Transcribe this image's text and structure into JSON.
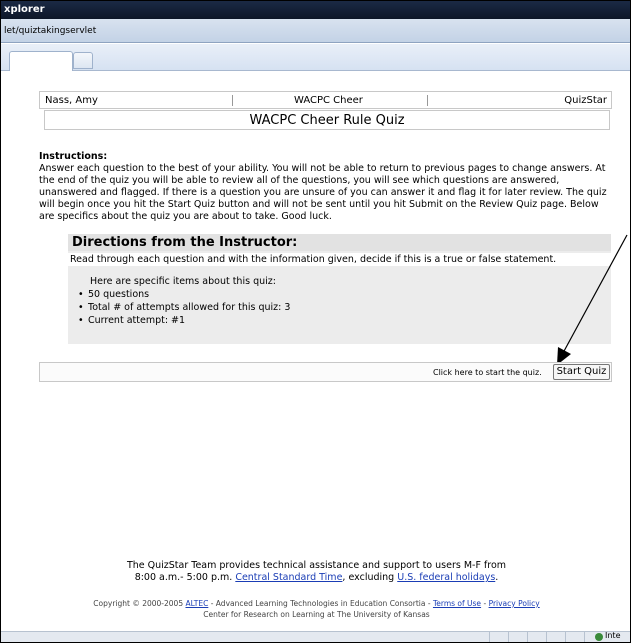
{
  "browser": {
    "title_fragment": "xplorer",
    "address_fragment": "let/quiztakingservlet",
    "status_zone": "Inte"
  },
  "header": {
    "user_name": "Nass, Amy",
    "group": "WACPC Cheer",
    "brand": "QuizStar",
    "quiz_title": "WACPC Cheer Rule Quiz"
  },
  "instructions": {
    "heading": "Instructions:",
    "body": "Answer each question to the best of your ability. You will not be able to return to previous pages to change answers. At the end of the quiz you will be able to review all of the questions, you will see which questions are answered, unanswered and flagged. If there is a question you are unsure of you can answer it and flag it for later review. The quiz will begin once you hit the Start Quiz button and will not be sent until you hit Submit on the Review Quiz page. Below are specifics about the quiz you are about to take. Good luck."
  },
  "directions": {
    "heading": "Directions from the Instructor:",
    "text": "Read through each question and with the information given, decide if this is a true or false statement.",
    "items_lead": "Here are specific items about this quiz:",
    "items": [
      "50 questions",
      "Total # of attempts allowed for this quiz: 3",
      "Current attempt: #1"
    ]
  },
  "start": {
    "prompt": "Click here to start the quiz.",
    "button_label": "Start Quiz"
  },
  "support": {
    "line1": "The QuizStar Team provides technical assistance and support to users M-F from",
    "line2_prefix": "8:00 a.m.- 5:00 p.m.",
    "link_timezone": "Central Standard Time",
    "line2_middle": ", excluding",
    "link_holidays": "U.S. federal holidays",
    "line2_suffix": "."
  },
  "footer": {
    "copyright_prefix": "Copyright © 2000-2005",
    "link_altec": "ALTEC",
    "copyright_middle": "- Advanced Learning Technologies in Education Consortia -",
    "link_terms": "Terms of Use",
    "separator": "-",
    "link_privacy": "Privacy Policy",
    "line2": "Center for Research on Learning at The University of Kansas"
  }
}
